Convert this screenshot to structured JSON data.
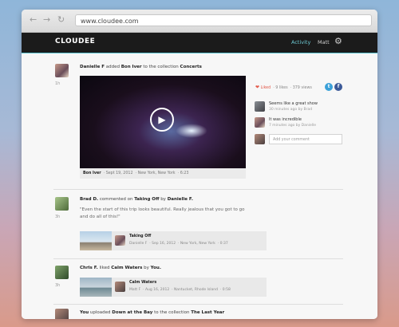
{
  "browser": {
    "url": "www.cloudee.com",
    "back_icon": "arrow-left-icon",
    "forward_icon": "arrow-right-icon",
    "reload_icon": "reload-icon"
  },
  "app": {
    "logo": "CLOUDEE",
    "nav_activity": "Activity",
    "nav_user": "Matt",
    "accent_color": "#5cc3cf"
  },
  "feed": {
    "post1": {
      "user": "Danielle F",
      "action": "added",
      "item": "Bon Iver",
      "mid": "to the collection",
      "collection": "Concerts",
      "time": "1h",
      "caption_title": "Bon Iver",
      "caption_date": "Sept 19, 2012",
      "caption_place": "New York, New York",
      "caption_duration": "6:23",
      "liked_label": "Liked",
      "likes": "9 likes",
      "views": "379 views",
      "comments": [
        {
          "text": "Seems like a great show",
          "meta": "30 minutes ago by Brad"
        },
        {
          "text": "It was incredible",
          "meta": "7 minutes ago by Danielle"
        }
      ],
      "comment_placeholder": "Add your comment"
    },
    "post2": {
      "user": "Brad D.",
      "action": "commented on",
      "item": "Taking Off",
      "mid": "by",
      "owner": "Danielle F.",
      "time": "3h",
      "quote": "\"Even the start of this trip looks beautiful. Really jealous that you got to go and do all of this!\"",
      "card_title": "Taking Off",
      "card_user": "Danielle F",
      "card_date": "Sep 16, 2012",
      "card_place": "New York, New York",
      "card_duration": "0:37"
    },
    "post3": {
      "user": "Chris F.",
      "action": "liked",
      "item": "Calm Waters",
      "mid": "by",
      "owner": "You.",
      "time": "3h",
      "card_title": "Calm Waters",
      "card_user": "Matt F",
      "card_date": "Aug 16, 2012",
      "card_place": "Nantucket, Rhode Island",
      "card_duration": "0:58"
    },
    "post4": {
      "user": "You",
      "action": "uploaded",
      "item": "Down at the Bay",
      "mid": "to the collection",
      "collection": "The Last Year"
    }
  }
}
